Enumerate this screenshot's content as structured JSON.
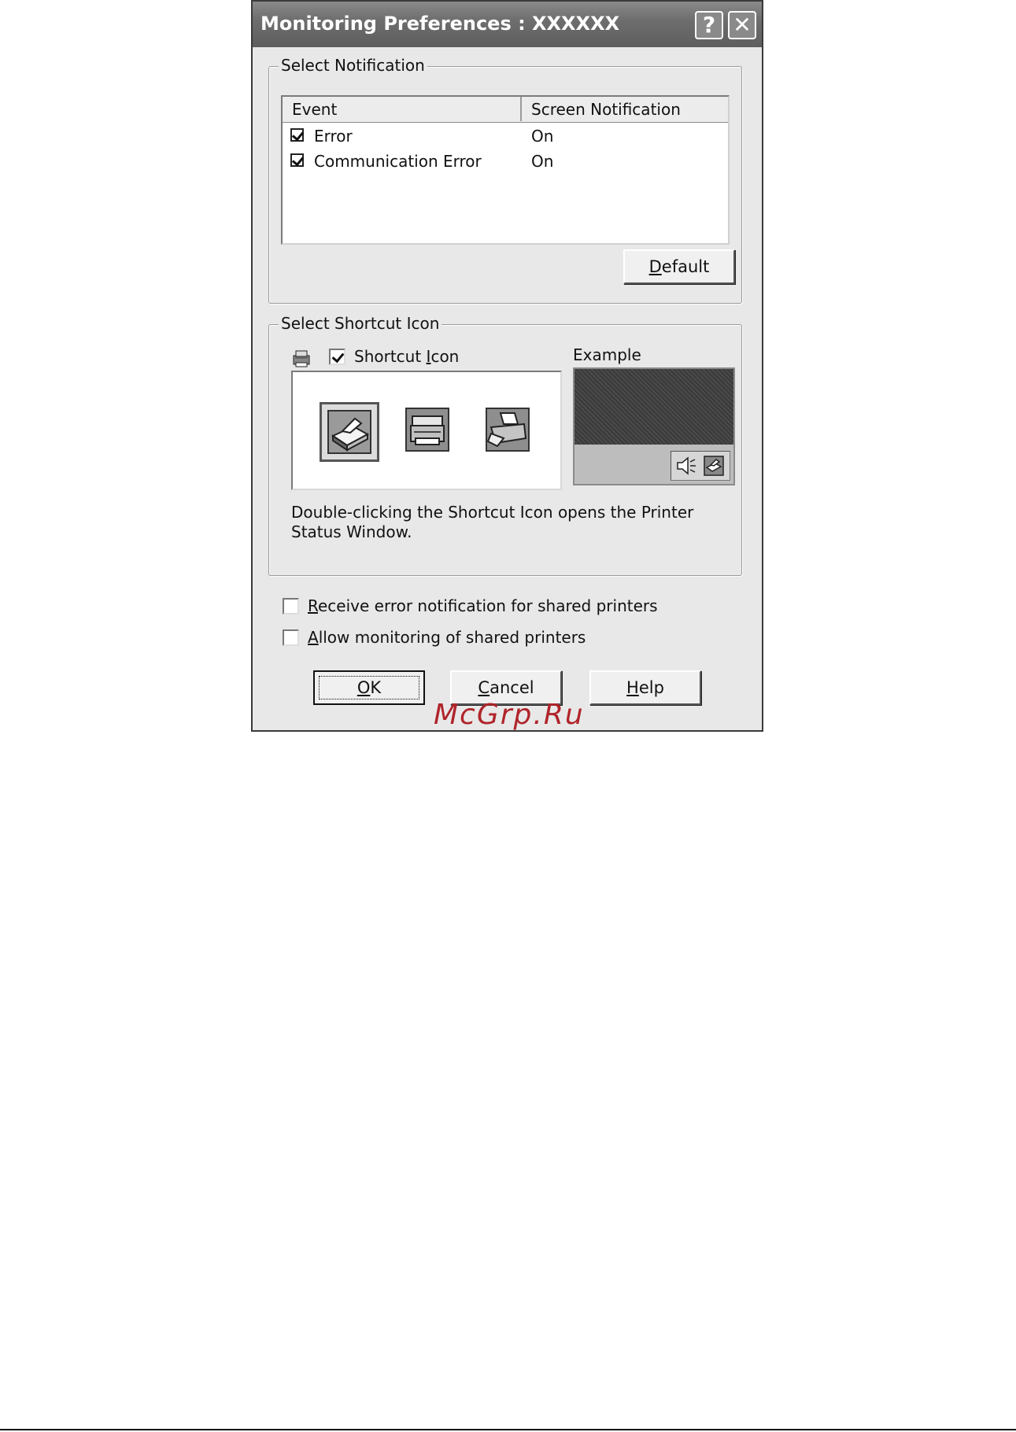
{
  "window": {
    "title": "Monitoring Preferences : XXXXXX",
    "help_glyph": "?",
    "close_glyph": "✕"
  },
  "notification": {
    "group_label": "Select Notification",
    "columns": [
      "Event",
      "Screen Notification"
    ],
    "rows": [
      {
        "event": "Error",
        "notification": "On",
        "checked": true
      },
      {
        "event": "Communication Error",
        "notification": "On",
        "checked": true
      }
    ],
    "default_button": {
      "accel": "D",
      "rest": "efault"
    }
  },
  "shortcut": {
    "group_label": "Select Shortcut Icon",
    "checkbox_label_pre": "Shortcut ",
    "checkbox_label_accel": "I",
    "checkbox_label_post": "con",
    "checked": true,
    "example_label": "Example",
    "description": "Double-clicking the Shortcut Icon opens the Printer Status Window.",
    "icons": [
      "printer-style-1-icon",
      "printer-style-2-icon",
      "printer-style-3-icon"
    ],
    "selected_icon_index": 0
  },
  "options": [
    {
      "accel": "R",
      "rest": "eceive error notification for shared printers",
      "checked": false
    },
    {
      "accel": "A",
      "rest": "llow monitoring of shared printers",
      "checked": false
    }
  ],
  "buttons": {
    "ok": {
      "accel": "O",
      "rest": "K"
    },
    "cancel": {
      "accel": "C",
      "rest": "ancel"
    },
    "help": {
      "accel": "H",
      "rest": "elp"
    }
  },
  "watermark": "McGrp.Ru",
  "colors": {
    "titlebar": "#6e6e6e",
    "dialog_bg": "#e8e8e8",
    "watermark": "#b0242a"
  }
}
